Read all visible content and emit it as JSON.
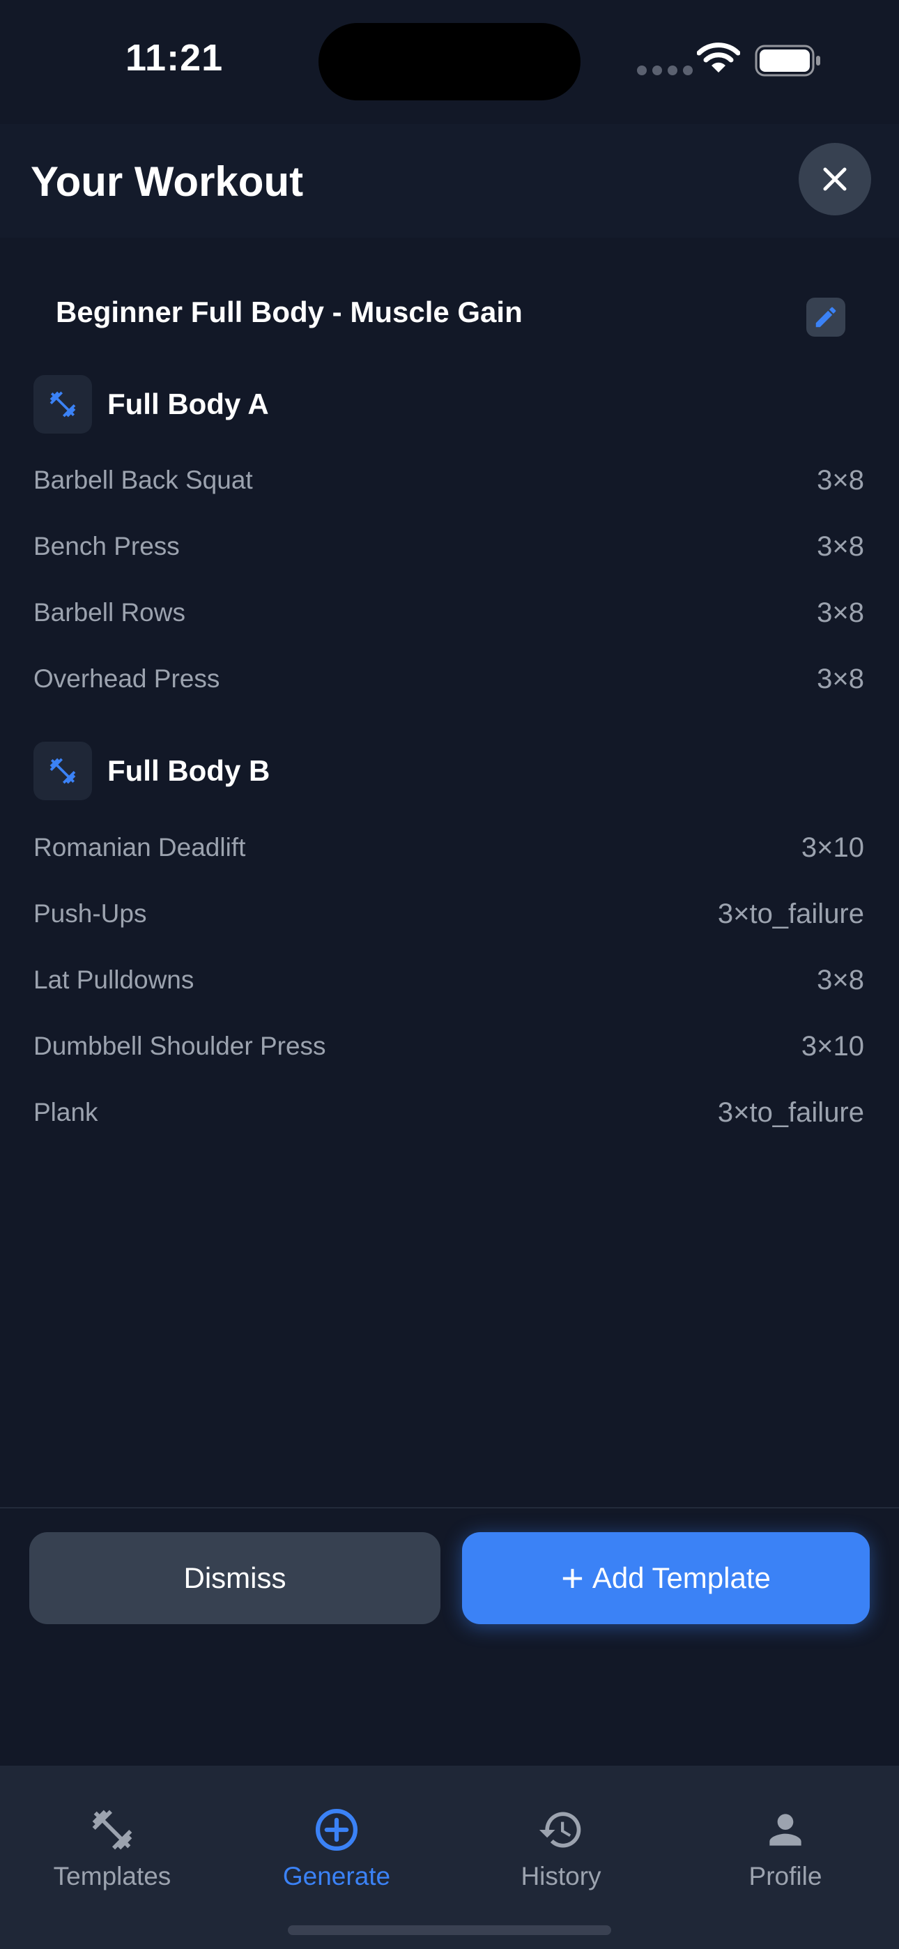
{
  "status_bar": {
    "time": "11:21"
  },
  "header": {
    "title": "Your Workout"
  },
  "plan": {
    "name": "Beginner Full Body - Muscle Gain"
  },
  "days": [
    {
      "name": "Full Body A",
      "exercises": [
        {
          "name": "Barbell Back Squat",
          "sets": "3×8"
        },
        {
          "name": "Bench Press",
          "sets": "3×8"
        },
        {
          "name": "Barbell Rows",
          "sets": "3×8"
        },
        {
          "name": "Overhead Press",
          "sets": "3×8"
        }
      ]
    },
    {
      "name": "Full Body B",
      "exercises": [
        {
          "name": "Romanian Deadlift",
          "sets": "3×10"
        },
        {
          "name": "Push-Ups",
          "sets": "3×to_failure"
        },
        {
          "name": "Lat Pulldowns",
          "sets": "3×8"
        },
        {
          "name": "Dumbbell Shoulder Press",
          "sets": "3×10"
        },
        {
          "name": "Plank",
          "sets": "3×to_failure"
        }
      ]
    }
  ],
  "actions": {
    "dismiss": "Dismiss",
    "add_template": "Add Template"
  },
  "tabs": [
    {
      "label": "Templates",
      "icon": "dumbbell-icon",
      "active": false
    },
    {
      "label": "Generate",
      "icon": "plus-circle-icon",
      "active": true
    },
    {
      "label": "History",
      "icon": "history-icon",
      "active": false
    },
    {
      "label": "Profile",
      "icon": "person-icon",
      "active": false
    }
  ],
  "colors": {
    "background": "#121827",
    "accent": "#3b82f6",
    "muted_text": "#9ca3af",
    "surface": "#374151"
  }
}
